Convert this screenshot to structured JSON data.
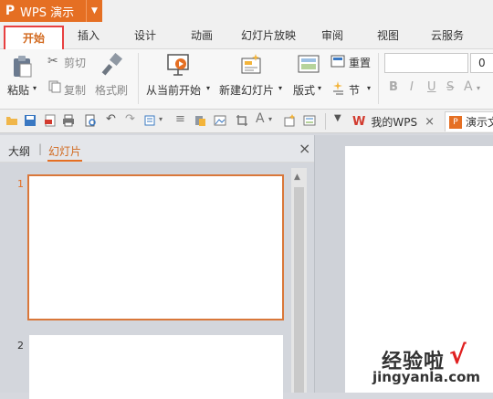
{
  "app": {
    "logo": "P",
    "title": "WPS 演示",
    "dropdown": "▼"
  },
  "tabs": [
    "开始",
    "插入",
    "设计",
    "动画",
    "幻灯片放映",
    "审阅",
    "视图",
    "云服务"
  ],
  "ribbon": {
    "paste": "粘贴",
    "cut": "剪切",
    "copy": "复制",
    "format_painter": "格式刷",
    "from_current": "从当前开始",
    "new_slide": "新建幻灯片",
    "layout": "版式",
    "reset": "重置",
    "section": "节",
    "font_size": "0",
    "font_styles": [
      "B",
      "I",
      "U",
      "S",
      "A"
    ]
  },
  "doc_tabs": {
    "my_wps": "我的WPS",
    "presentation": "演示文"
  },
  "pane": {
    "tab_outline": "大纲",
    "tab_slides": "幻灯片",
    "close": "×",
    "slide_numbers": [
      "1",
      "2"
    ]
  },
  "watermark": {
    "line1": "经验啦",
    "line2": "jingyanla.com",
    "check": "√"
  },
  "colors": {
    "accent": "#e56f23",
    "highlight_box": "#e84040",
    "selected_slide_border": "#d9773a"
  }
}
